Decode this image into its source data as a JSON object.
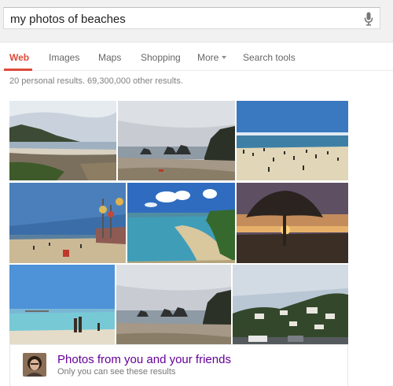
{
  "search": {
    "query": "my photos of beaches",
    "mic_icon": "microphone-icon"
  },
  "tabs": [
    {
      "label": "Web",
      "active": true
    },
    {
      "label": "Images",
      "active": false
    },
    {
      "label": "Maps",
      "active": false
    },
    {
      "label": "Shopping",
      "active": false
    },
    {
      "label": "More",
      "active": false
    },
    {
      "label": "Search tools",
      "active": false
    }
  ],
  "result_stats": "20 personal results. 69,300,000 other results.",
  "photo_card": {
    "title": "Photos from you and your friends",
    "subtitle": "Only you can see these results"
  },
  "colors": {
    "accent": "#dd4b39",
    "visited_link": "#660099"
  }
}
